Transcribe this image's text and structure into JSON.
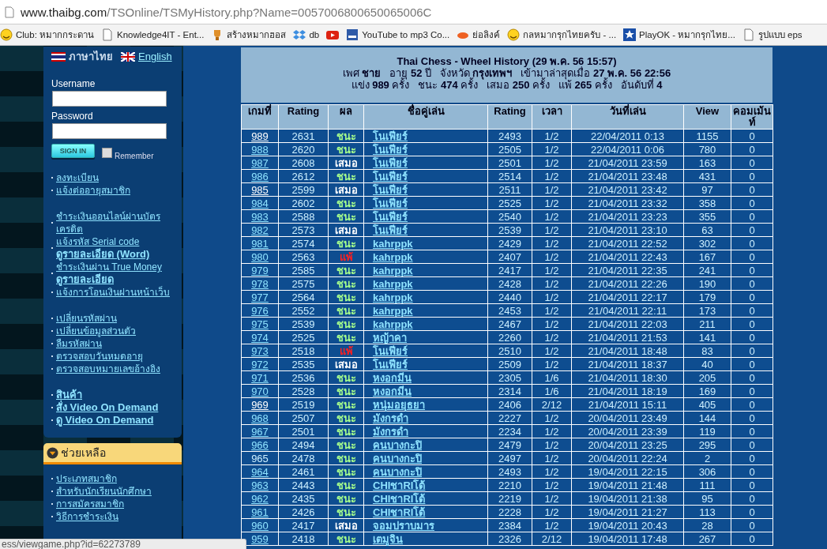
{
  "address_bar": {
    "host": "www.thaibg.com",
    "path": "/TSOnline/TSMyHistory.php?Name=0057006800650065006C"
  },
  "bookmarks": [
    {
      "kind": "smiley",
      "label": "Club: หมากกระดาน"
    },
    {
      "kind": "page",
      "label": "Knowledge4IT - Ent..."
    },
    {
      "kind": "trophy",
      "label": "สร้างหมากฮอส"
    },
    {
      "kind": "dropbox",
      "label": "db"
    },
    {
      "kind": "youtube"
    },
    {
      "kind": "ytmp3",
      "label": "YouTube to mp3 Co..."
    },
    {
      "kind": "bitly",
      "label": "ย่อลิงค์"
    },
    {
      "kind": "smiley",
      "label": "กลหมากรุกไทยครับ - ..."
    },
    {
      "kind": "star",
      "label": "PlayOK - หมากรุกไทย..."
    },
    {
      "kind": "page",
      "label": "รูปแบบ eps"
    }
  ],
  "sidebar": {
    "languages": [
      {
        "kind": "thai",
        "label": "ภาษาไทย"
      },
      {
        "kind": "uk",
        "label": "English"
      }
    ],
    "username_label": "Username",
    "password_label": "Password",
    "sign_in": "SIGN IN",
    "remember": {
      "label": "Remember",
      "checked": false
    },
    "link_groups": [
      [
        {
          "links": [
            {
              "text": "ลงทะเบียน",
              "bold": false
            }
          ]
        },
        {
          "links": [
            {
              "text": "แจ้งต่ออายุสมาชิก",
              "bold": false
            }
          ]
        }
      ],
      [
        {
          "links": [
            {
              "text": "ชำระเงินออนไลน์ผ่านบัตรเครดิต",
              "bold": false
            }
          ]
        },
        {
          "links": [
            {
              "text": "แจ้งรหัส Serial code",
              "bold": false
            },
            {
              "text": "ดูรายละเอียด (Word)",
              "bold": true
            }
          ]
        },
        {
          "links": [
            {
              "text": "ชำระเงินผ่าน True Money",
              "bold": false
            },
            {
              "text": "ดูรายละเอียด",
              "bold": true
            }
          ]
        },
        {
          "links": [
            {
              "text": "แจ้งการโอนเงินผ่านหน้าเว็บ",
              "bold": false
            }
          ]
        }
      ],
      [
        {
          "links": [
            {
              "text": "เปลี่ยนรหัสผ่าน",
              "bold": false
            }
          ]
        },
        {
          "links": [
            {
              "text": "เปลี่ยนข้อมูลส่วนตัว",
              "bold": false
            }
          ]
        },
        {
          "links": [
            {
              "text": "ลืมรหัสผ่าน",
              "bold": false
            }
          ]
        },
        {
          "links": [
            {
              "text": "ตรวจสอบวันหมดอายุ",
              "bold": false
            }
          ]
        },
        {
          "links": [
            {
              "text": "ตรวจสอบหมายเลขอ้างอิง",
              "bold": false
            }
          ]
        }
      ],
      [
        {
          "links": [
            {
              "text": "สินค้า",
              "bold": true
            }
          ]
        },
        {
          "links": [
            {
              "text": "สั่ง Video On Demand",
              "bold": true
            }
          ]
        },
        {
          "links": [
            {
              "text": "ดู Video On Demand",
              "bold": true
            }
          ]
        }
      ]
    ],
    "help": {
      "title": "ช่วยเหลือ",
      "links": [
        "ประเภทสมาชิก",
        "สำหรับนักเรียนนักศึกษา",
        "การสมัครสมาชิก",
        "วิธีการชำระเงิน"
      ]
    }
  },
  "profile": {
    "title": "Thai Chess - Wheel History  (29 พ.ค. 56 15:57)",
    "lines": [
      "เพศ **ชาย**   อายุ **52** ปี   จังหวัด **กรุงเทพฯ**   เข้ามาล่าสุดเมื่อ **27 พ.ค. 56 22:56**",
      "แข่ง **989** ครั้ง   ชนะ **474** ครั้ง   เสมอ **250** ครั้ง   แพ้ **265** ครั้ง   อันดับที่ **4**"
    ]
  },
  "table": {
    "columns": [
      "เกมที่",
      "Rating",
      "ผล",
      "ชื่อคู่เล่น",
      "Rating",
      "เวลา",
      "วันที่เล่น",
      "View",
      "คอมเม้นท์"
    ],
    "rows": [
      {
        "game": "989",
        "link": true,
        "visited": true,
        "rating": "2631",
        "result": {
          "text": "ชนะ",
          "kind": "win"
        },
        "opponent": "โนเฟียร์",
        "opp_rating": "2493",
        "time": "1/2",
        "date": "22/04/2011 0:13",
        "views": "1155",
        "comments": "0"
      },
      {
        "game": "988",
        "link": true,
        "visited": false,
        "rating": "2620",
        "result": {
          "text": "ชนะ",
          "kind": "win"
        },
        "opponent": "โนเฟียร์",
        "opp_rating": "2505",
        "time": "1/2",
        "date": "22/04/2011 0:06",
        "views": "780",
        "comments": "0"
      },
      {
        "game": "987",
        "link": true,
        "visited": false,
        "rating": "2608",
        "result": {
          "text": "เสมอ",
          "kind": "draw"
        },
        "opponent": "โนเฟียร์",
        "opp_rating": "2501",
        "time": "1/2",
        "date": "21/04/2011 23:59",
        "views": "163",
        "comments": "0"
      },
      {
        "game": "986",
        "link": true,
        "visited": false,
        "rating": "2612",
        "result": {
          "text": "ชนะ",
          "kind": "win"
        },
        "opponent": "โนเฟียร์",
        "opp_rating": "2514",
        "time": "1/2",
        "date": "21/04/2011 23:48",
        "views": "431",
        "comments": "0"
      },
      {
        "game": "985",
        "link": true,
        "visited": true,
        "rating": "2599",
        "result": {
          "text": "เสมอ",
          "kind": "draw"
        },
        "opponent": "โนเฟียร์",
        "opp_rating": "2511",
        "time": "1/2",
        "date": "21/04/2011 23:42",
        "views": "97",
        "comments": "0"
      },
      {
        "game": "984",
        "link": true,
        "visited": false,
        "rating": "2602",
        "result": {
          "text": "ชนะ",
          "kind": "win"
        },
        "opponent": "โนเฟียร์",
        "opp_rating": "2525",
        "time": "1/2",
        "date": "21/04/2011 23:32",
        "views": "358",
        "comments": "0"
      },
      {
        "game": "983",
        "link": true,
        "visited": false,
        "rating": "2588",
        "result": {
          "text": "ชนะ",
          "kind": "win"
        },
        "opponent": "โนเฟียร์",
        "opp_rating": "2540",
        "time": "1/2",
        "date": "21/04/2011 23:23",
        "views": "355",
        "comments": "0"
      },
      {
        "game": "982",
        "link": true,
        "visited": false,
        "rating": "2573",
        "result": {
          "text": "เสมอ",
          "kind": "draw"
        },
        "opponent": "โนเฟียร์",
        "opp_rating": "2539",
        "time": "1/2",
        "date": "21/04/2011 23:10",
        "views": "63",
        "comments": "0"
      },
      {
        "game": "981",
        "link": true,
        "visited": false,
        "rating": "2574",
        "result": {
          "text": "ชนะ",
          "kind": "win"
        },
        "opponent": "kahrppk",
        "opp_rating": "2429",
        "time": "1/2",
        "date": "21/04/2011 22:52",
        "views": "302",
        "comments": "0"
      },
      {
        "game": "980",
        "link": true,
        "visited": false,
        "rating": "2563",
        "result": {
          "text": "แพ้",
          "kind": "loss"
        },
        "opponent": "kahrppk",
        "opp_rating": "2407",
        "time": "1/2",
        "date": "21/04/2011 22:43",
        "views": "167",
        "comments": "0"
      },
      {
        "game": "979",
        "link": true,
        "visited": false,
        "rating": "2585",
        "result": {
          "text": "ชนะ",
          "kind": "win"
        },
        "opponent": "kahrppk",
        "opp_rating": "2417",
        "time": "1/2",
        "date": "21/04/2011 22:35",
        "views": "241",
        "comments": "0"
      },
      {
        "game": "978",
        "link": true,
        "visited": false,
        "rating": "2575",
        "result": {
          "text": "ชนะ",
          "kind": "win"
        },
        "opponent": "kahrppk",
        "opp_rating": "2428",
        "time": "1/2",
        "date": "21/04/2011 22:26",
        "views": "190",
        "comments": "0"
      },
      {
        "game": "977",
        "link": true,
        "visited": false,
        "rating": "2564",
        "result": {
          "text": "ชนะ",
          "kind": "win"
        },
        "opponent": "kahrppk",
        "opp_rating": "2440",
        "time": "1/2",
        "date": "21/04/2011 22:17",
        "views": "179",
        "comments": "0"
      },
      {
        "game": "976",
        "link": true,
        "visited": false,
        "rating": "2552",
        "result": {
          "text": "ชนะ",
          "kind": "win"
        },
        "opponent": "kahrppk",
        "opp_rating": "2453",
        "time": "1/2",
        "date": "21/04/2011 22:11",
        "views": "173",
        "comments": "0"
      },
      {
        "game": "975",
        "link": true,
        "visited": false,
        "rating": "2539",
        "result": {
          "text": "ชนะ",
          "kind": "win"
        },
        "opponent": "kahrppk",
        "opp_rating": "2467",
        "time": "1/2",
        "date": "21/04/2011 22:03",
        "views": "211",
        "comments": "0"
      },
      {
        "game": "974",
        "link": true,
        "visited": false,
        "rating": "2525",
        "result": {
          "text": "ชนะ",
          "kind": "win"
        },
        "opponent": "หญ้าคา",
        "opp_rating": "2260",
        "time": "1/2",
        "date": "21/04/2011 21:53",
        "views": "141",
        "comments": "0"
      },
      {
        "game": "973",
        "link": true,
        "visited": false,
        "rating": "2518",
        "result": {
          "text": "แพ้",
          "kind": "loss"
        },
        "opponent": "โนเฟียร์",
        "opp_rating": "2510",
        "time": "1/2",
        "date": "21/04/2011 18:48",
        "views": "83",
        "comments": "0"
      },
      {
        "game": "972",
        "link": true,
        "visited": false,
        "rating": "2535",
        "result": {
          "text": "เสมอ",
          "kind": "draw"
        },
        "opponent": "โนเฟียร์",
        "opp_rating": "2509",
        "time": "1/2",
        "date": "21/04/2011 18:37",
        "views": "40",
        "comments": "0"
      },
      {
        "game": "971",
        "link": true,
        "visited": false,
        "rating": "2536",
        "result": {
          "text": "ชนะ",
          "kind": "win"
        },
        "opponent": "หงอกมีน",
        "opp_rating": "2305",
        "time": "1/6",
        "date": "21/04/2011 18:30",
        "views": "205",
        "comments": "0"
      },
      {
        "game": "970",
        "link": true,
        "visited": false,
        "rating": "2528",
        "result": {
          "text": "ชนะ",
          "kind": "win"
        },
        "opponent": "หงอกมีน",
        "opp_rating": "2314",
        "time": "1/6",
        "date": "21/04/2011 18:19",
        "views": "169",
        "comments": "0"
      },
      {
        "game": "969",
        "link": true,
        "visited": true,
        "rating": "2519",
        "result": {
          "text": "ชนะ",
          "kind": "win"
        },
        "opponent": "หนุ่มอยุธยา",
        "opp_rating": "2406",
        "time": "2/12",
        "date": "21/04/2011 15:11",
        "views": "405",
        "comments": "0"
      },
      {
        "game": "968",
        "link": true,
        "visited": false,
        "rating": "2507",
        "result": {
          "text": "ชนะ",
          "kind": "win"
        },
        "opponent": "มังกรดำ",
        "opp_rating": "2227",
        "time": "1/2",
        "date": "20/04/2011 23:49",
        "views": "144",
        "comments": "0"
      },
      {
        "game": "967",
        "link": true,
        "visited": false,
        "rating": "2501",
        "result": {
          "text": "ชนะ",
          "kind": "win"
        },
        "opponent": "มังกรดำ",
        "opp_rating": "2234",
        "time": "1/2",
        "date": "20/04/2011 23:39",
        "views": "119",
        "comments": "0"
      },
      {
        "game": "966",
        "link": true,
        "visited": false,
        "rating": "2494",
        "result": {
          "text": "ชนะ",
          "kind": "win"
        },
        "opponent": "คนบางกะปิ",
        "opp_rating": "2479",
        "time": "1/2",
        "date": "20/04/2011 23:25",
        "views": "295",
        "comments": "0"
      },
      {
        "game": "965",
        "link": false,
        "rating": "2478",
        "result": {
          "text": "ชนะ",
          "kind": "win"
        },
        "opponent": "คนบางกะปิ",
        "opp_rating": "2497",
        "time": "1/2",
        "date": "20/04/2011 22:24",
        "views": "2",
        "comments": "0"
      },
      {
        "game": "964",
        "link": true,
        "visited": false,
        "rating": "2461",
        "result": {
          "text": "ชนะ",
          "kind": "win"
        },
        "opponent": "คนบางกะปิ",
        "opp_rating": "2493",
        "time": "1/2",
        "date": "19/04/2011 22:15",
        "views": "306",
        "comments": "0"
      },
      {
        "game": "963",
        "link": true,
        "visited": false,
        "rating": "2443",
        "result": {
          "text": "ชนะ",
          "kind": "win"
        },
        "opponent": "CHIชาRIโต้",
        "opp_rating": "2210",
        "time": "1/2",
        "date": "19/04/2011 21:48",
        "views": "111",
        "comments": "0"
      },
      {
        "game": "962",
        "link": true,
        "visited": false,
        "rating": "2435",
        "result": {
          "text": "ชนะ",
          "kind": "win"
        },
        "opponent": "CHIชาRIโต้",
        "opp_rating": "2219",
        "time": "1/2",
        "date": "19/04/2011 21:38",
        "views": "95",
        "comments": "0"
      },
      {
        "game": "961",
        "link": true,
        "visited": false,
        "rating": "2426",
        "result": {
          "text": "ชนะ",
          "kind": "win"
        },
        "opponent": "CHIชาRIโต้",
        "opp_rating": "2228",
        "time": "1/2",
        "date": "19/04/2011 21:27",
        "views": "113",
        "comments": "0"
      },
      {
        "game": "960",
        "link": true,
        "visited": false,
        "rating": "2417",
        "result": {
          "text": "เสมอ",
          "kind": "draw"
        },
        "opponent": "จอมปราบมาร",
        "opp_rating": "2384",
        "time": "1/2",
        "date": "19/04/2011 20:43",
        "views": "28",
        "comments": "0"
      },
      {
        "game": "959",
        "link": true,
        "visited": false,
        "rating": "2418",
        "result": {
          "text": "ชนะ",
          "kind": "win"
        },
        "opponent": "เตมูจิน",
        "opp_rating": "2326",
        "time": "2/12",
        "date": "19/04/2011 17:48",
        "views": "267",
        "comments": "0"
      }
    ]
  },
  "status_bar": "ess/viewgame.php?id=62273789"
}
